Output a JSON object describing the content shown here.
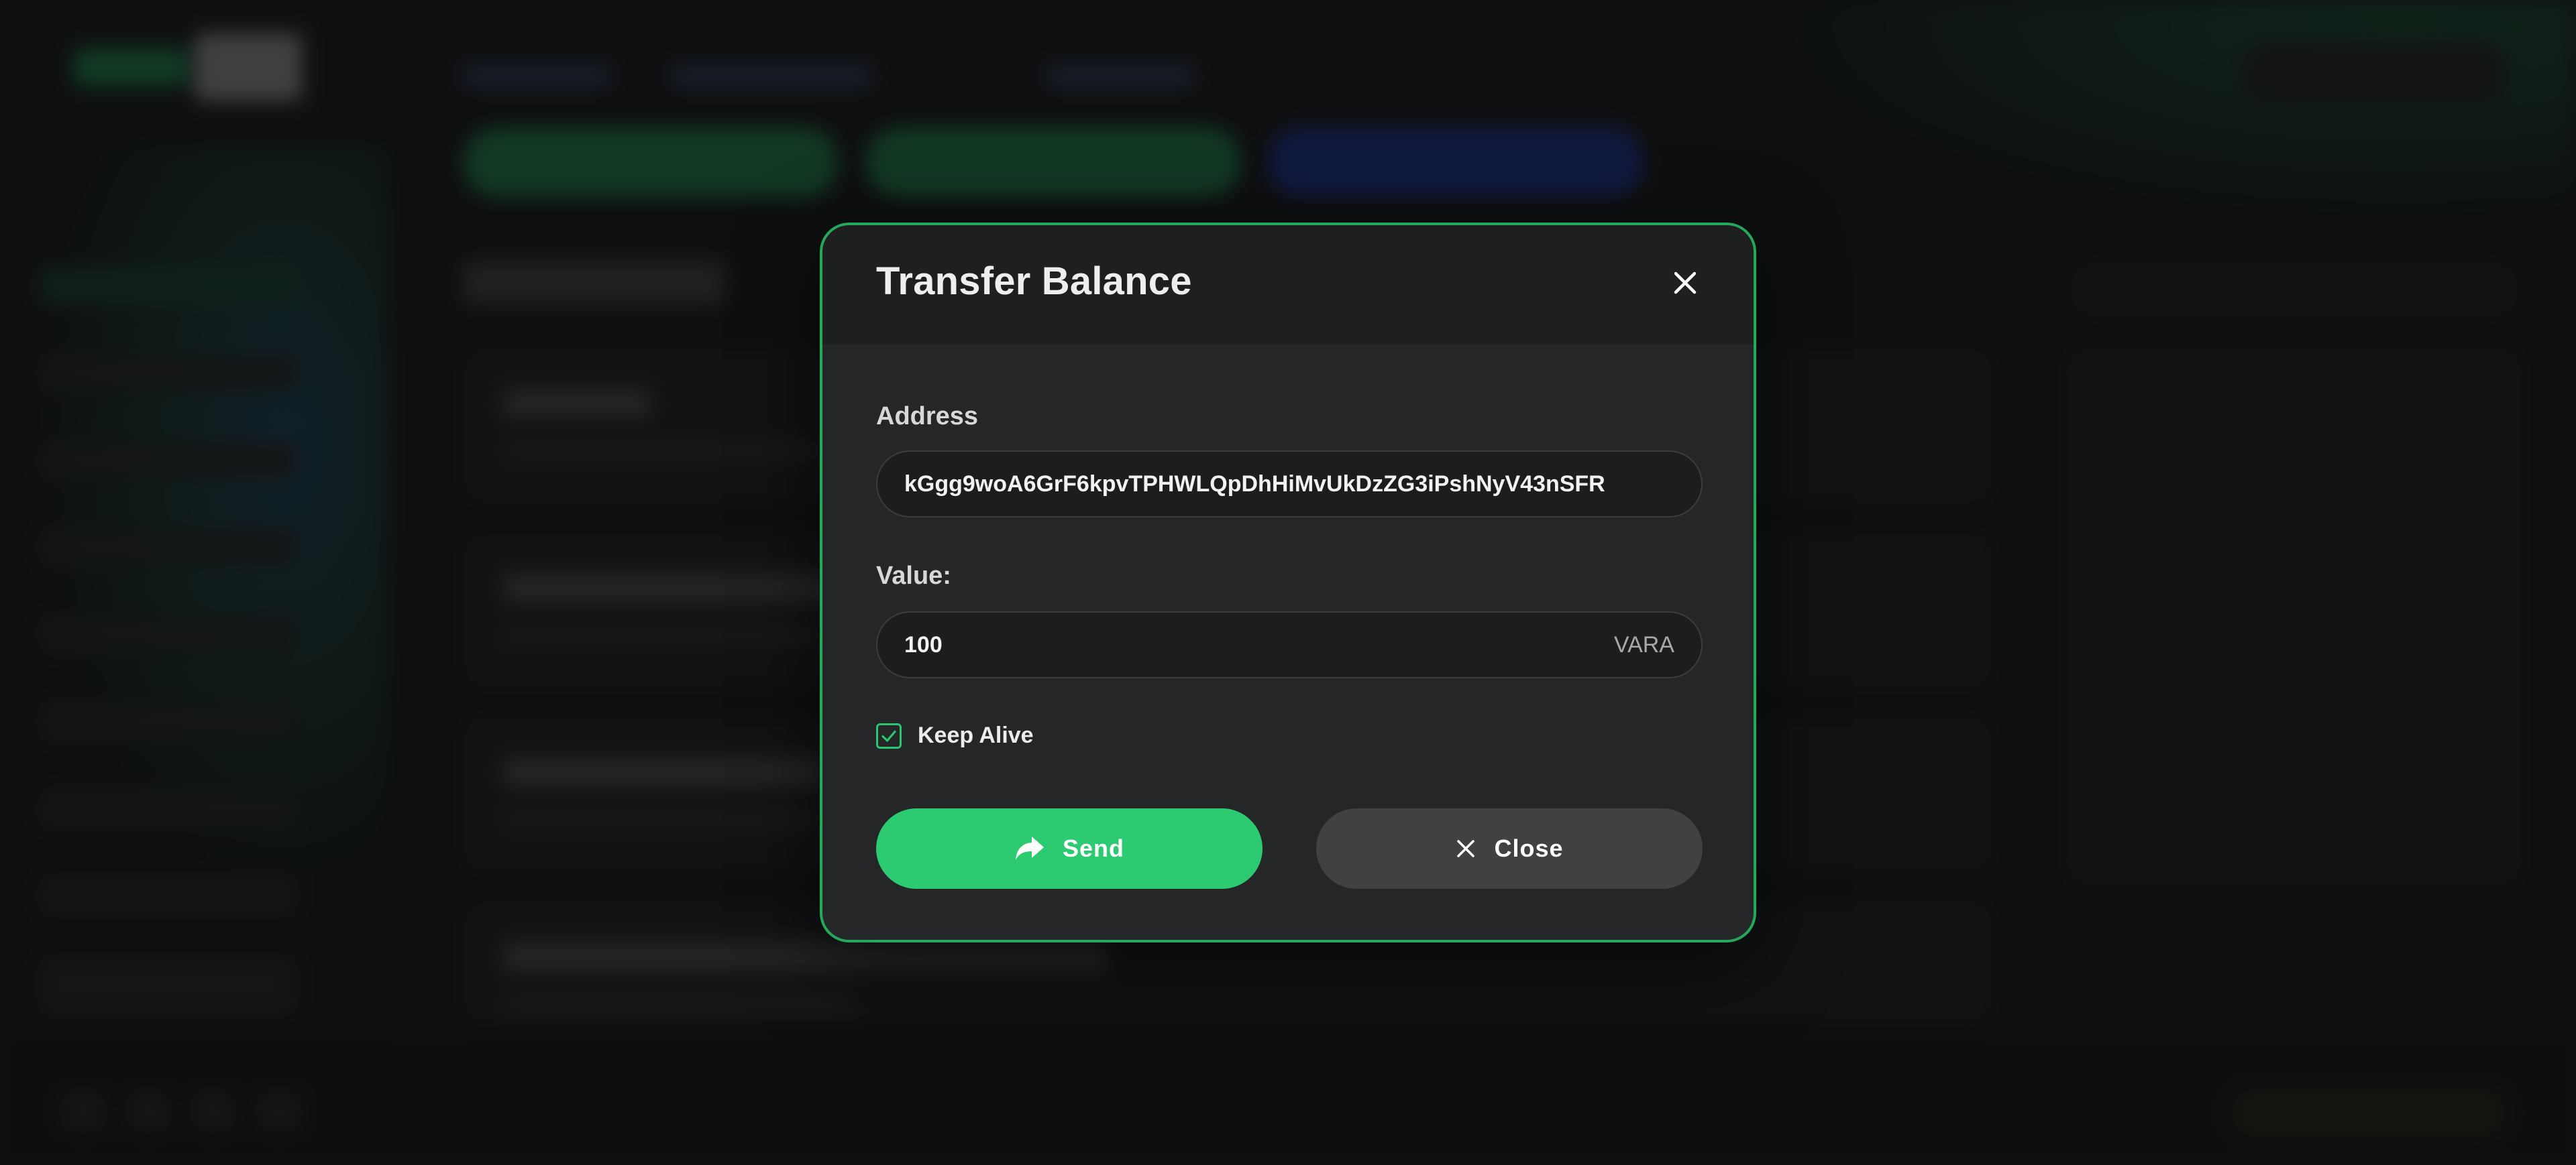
{
  "modal": {
    "title": "Transfer Balance",
    "address_label": "Address",
    "address_value": "kGgg9woA6GrF6kpvTPHWLQpDhHiMvUkDzZG3iPshNyV43nSFR",
    "value_label": "Value:",
    "value_amount": "100",
    "value_unit": "VARA",
    "keep_alive_label": "Keep Alive",
    "keep_alive_checked": true,
    "send_label": "Send",
    "close_label": "Close"
  },
  "colors": {
    "accent": "#2ccb71",
    "modal_border": "#24a85c",
    "modal_bg": "#252628",
    "close_button_bg": "#404143"
  },
  "icons": {
    "close": "close-icon",
    "send": "share-arrow-icon",
    "checkbox": "check-icon"
  }
}
